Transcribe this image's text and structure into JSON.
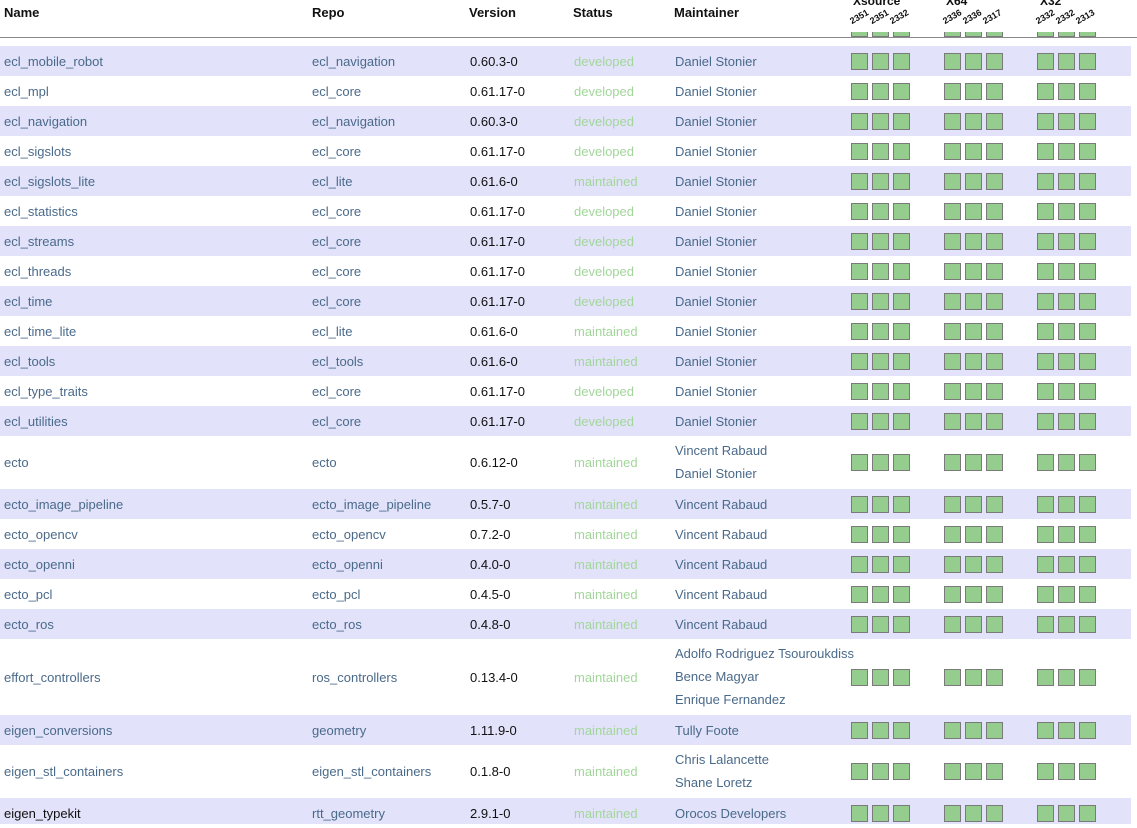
{
  "columns": {
    "name": "Name",
    "repo": "Repo",
    "version": "Version",
    "status": "Status",
    "maintainer": "Maintainer"
  },
  "groups": [
    {
      "label": "Xsource",
      "builds": [
        "2351",
        "2351",
        "2332"
      ]
    },
    {
      "label": "X64",
      "builds": [
        "2336",
        "2336",
        "2317"
      ]
    },
    {
      "label": "X32",
      "builds": [
        "2332",
        "2332",
        "2313"
      ]
    }
  ],
  "build_status_color": "#95cd8f",
  "status_color": "#a2d69a",
  "link_color": "#4a6a8a",
  "rows": [
    {
      "name": "ecl_mobile_robot",
      "repo": "ecl_navigation",
      "version": "0.60.3-0",
      "status": "developed",
      "maintainers": [
        "Daniel Stonier"
      ]
    },
    {
      "name": "ecl_mpl",
      "repo": "ecl_core",
      "version": "0.61.17-0",
      "status": "developed",
      "maintainers": [
        "Daniel Stonier"
      ]
    },
    {
      "name": "ecl_navigation",
      "repo": "ecl_navigation",
      "version": "0.60.3-0",
      "status": "developed",
      "maintainers": [
        "Daniel Stonier"
      ]
    },
    {
      "name": "ecl_sigslots",
      "repo": "ecl_core",
      "version": "0.61.17-0",
      "status": "developed",
      "maintainers": [
        "Daniel Stonier"
      ]
    },
    {
      "name": "ecl_sigslots_lite",
      "repo": "ecl_lite",
      "version": "0.61.6-0",
      "status": "maintained",
      "maintainers": [
        "Daniel Stonier"
      ]
    },
    {
      "name": "ecl_statistics",
      "repo": "ecl_core",
      "version": "0.61.17-0",
      "status": "developed",
      "maintainers": [
        "Daniel Stonier"
      ]
    },
    {
      "name": "ecl_streams",
      "repo": "ecl_core",
      "version": "0.61.17-0",
      "status": "developed",
      "maintainers": [
        "Daniel Stonier"
      ]
    },
    {
      "name": "ecl_threads",
      "repo": "ecl_core",
      "version": "0.61.17-0",
      "status": "developed",
      "maintainers": [
        "Daniel Stonier"
      ]
    },
    {
      "name": "ecl_time",
      "repo": "ecl_core",
      "version": "0.61.17-0",
      "status": "developed",
      "maintainers": [
        "Daniel Stonier"
      ]
    },
    {
      "name": "ecl_time_lite",
      "repo": "ecl_lite",
      "version": "0.61.6-0",
      "status": "maintained",
      "maintainers": [
        "Daniel Stonier"
      ]
    },
    {
      "name": "ecl_tools",
      "repo": "ecl_tools",
      "version": "0.61.6-0",
      "status": "maintained",
      "maintainers": [
        "Daniel Stonier"
      ]
    },
    {
      "name": "ecl_type_traits",
      "repo": "ecl_core",
      "version": "0.61.17-0",
      "status": "developed",
      "maintainers": [
        "Daniel Stonier"
      ]
    },
    {
      "name": "ecl_utilities",
      "repo": "ecl_core",
      "version": "0.61.17-0",
      "status": "developed",
      "maintainers": [
        "Daniel Stonier"
      ]
    },
    {
      "name": "ecto",
      "repo": "ecto",
      "version": "0.6.12-0",
      "status": "maintained",
      "maintainers": [
        "Vincent Rabaud",
        "Daniel Stonier"
      ]
    },
    {
      "name": "ecto_image_pipeline",
      "repo": "ecto_image_pipeline",
      "version": "0.5.7-0",
      "status": "maintained",
      "maintainers": [
        "Vincent Rabaud"
      ]
    },
    {
      "name": "ecto_opencv",
      "repo": "ecto_opencv",
      "version": "0.7.2-0",
      "status": "maintained",
      "maintainers": [
        "Vincent Rabaud"
      ]
    },
    {
      "name": "ecto_openni",
      "repo": "ecto_openni",
      "version": "0.4.0-0",
      "status": "maintained",
      "maintainers": [
        "Vincent Rabaud"
      ]
    },
    {
      "name": "ecto_pcl",
      "repo": "ecto_pcl",
      "version": "0.4.5-0",
      "status": "maintained",
      "maintainers": [
        "Vincent Rabaud"
      ]
    },
    {
      "name": "ecto_ros",
      "repo": "ecto_ros",
      "version": "0.4.8-0",
      "status": "maintained",
      "maintainers": [
        "Vincent Rabaud"
      ]
    },
    {
      "name": "effort_controllers",
      "repo": "ros_controllers",
      "version": "0.13.4-0",
      "status": "maintained",
      "maintainers": [
        "Adolfo Rodriguez Tsouroukdiss",
        "Bence Magyar",
        "Enrique Fernandez"
      ]
    },
    {
      "name": "eigen_conversions",
      "repo": "geometry",
      "version": "1.11.9-0",
      "status": "maintained",
      "maintainers": [
        "Tully Foote"
      ]
    },
    {
      "name": "eigen_stl_containers",
      "repo": "eigen_stl_containers",
      "version": "0.1.8-0",
      "status": "maintained",
      "maintainers": [
        "Chris Lalancette",
        "Shane Loretz"
      ]
    },
    {
      "name": "eigen_typekit",
      "repo": "rtt_geometry",
      "version": "2.9.1-0",
      "status": "maintained",
      "maintainers": [
        "Orocos Developers"
      ],
      "name_plain": true
    }
  ]
}
